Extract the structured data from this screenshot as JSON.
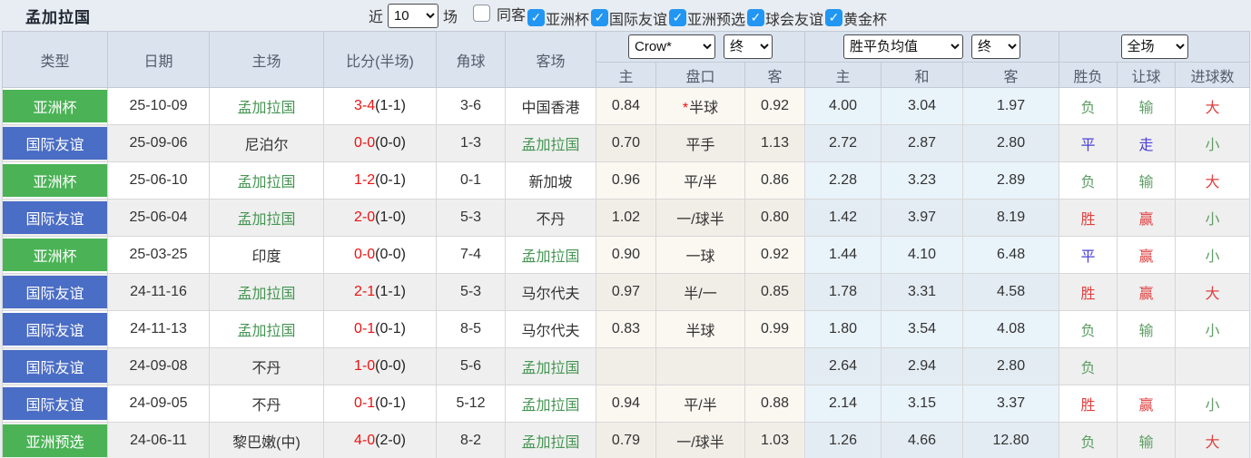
{
  "header_bar": {
    "title": "孟加拉国",
    "recent_label": "近",
    "recent_value": "10",
    "matches_label": "场",
    "checkboxes": [
      {
        "label": "同客",
        "checked": false
      },
      {
        "label": "亚洲杯",
        "checked": true
      },
      {
        "label": "国际友谊",
        "checked": true
      },
      {
        "label": "亚洲预选",
        "checked": true
      },
      {
        "label": "球会友谊",
        "checked": true
      },
      {
        "label": "黄金杯",
        "checked": true
      }
    ]
  },
  "table": {
    "columns": {
      "type": "类型",
      "date": "日期",
      "home": "主场",
      "score": "比分(半场)",
      "corners": "角球",
      "away": "客场"
    },
    "selects": {
      "company": "Crow*",
      "asian_time": "终",
      "euro": "胜平负均值",
      "euro_time": "终",
      "scope": "全场"
    },
    "subheaders": [
      "主",
      "盘口",
      "客",
      "主",
      "和",
      "客",
      "胜负",
      "让球",
      "进球数"
    ],
    "rows": [
      {
        "type": "亚洲杯",
        "type_color": "green",
        "date": "25-10-09",
        "home": "孟加拉国",
        "home_focus": true,
        "score_ft": "3-4",
        "score_ht": "(1-1)",
        "corners": "3-6",
        "away": "中国香港",
        "away_focus": false,
        "asian_home": "0.84",
        "handicap": "半球",
        "handicap_star": true,
        "asian_away": "0.92",
        "euro_home": "4.00",
        "euro_draw": "3.04",
        "euro_away": "1.97",
        "result": "负",
        "handicap_result": "输",
        "goals": "大"
      },
      {
        "type": "国际友谊",
        "type_color": "blue",
        "date": "25-09-06",
        "home": "尼泊尔",
        "home_focus": false,
        "score_ft": "0-0",
        "score_ht": "(0-0)",
        "corners": "1-3",
        "away": "孟加拉国",
        "away_focus": true,
        "asian_home": "0.70",
        "handicap": "平手",
        "handicap_star": false,
        "asian_away": "1.13",
        "euro_home": "2.72",
        "euro_draw": "2.87",
        "euro_away": "2.80",
        "result": "平",
        "handicap_result": "走",
        "goals": "小"
      },
      {
        "type": "亚洲杯",
        "type_color": "green",
        "date": "25-06-10",
        "home": "孟加拉国",
        "home_focus": true,
        "score_ft": "1-2",
        "score_ht": "(0-1)",
        "corners": "0-1",
        "away": "新加坡",
        "away_focus": false,
        "asian_home": "0.96",
        "handicap": "平/半",
        "handicap_star": false,
        "asian_away": "0.86",
        "euro_home": "2.28",
        "euro_draw": "3.23",
        "euro_away": "2.89",
        "result": "负",
        "handicap_result": "输",
        "goals": "大"
      },
      {
        "type": "国际友谊",
        "type_color": "blue",
        "date": "25-06-04",
        "home": "孟加拉国",
        "home_focus": true,
        "score_ft": "2-0",
        "score_ht": "(1-0)",
        "corners": "5-3",
        "away": "不丹",
        "away_focus": false,
        "asian_home": "1.02",
        "handicap": "一/球半",
        "handicap_star": false,
        "asian_away": "0.80",
        "euro_home": "1.42",
        "euro_draw": "3.97",
        "euro_away": "8.19",
        "result": "胜",
        "handicap_result": "赢",
        "goals": "小"
      },
      {
        "type": "亚洲杯",
        "type_color": "green",
        "date": "25-03-25",
        "home": "印度",
        "home_focus": false,
        "score_ft": "0-0",
        "score_ht": "(0-0)",
        "corners": "7-4",
        "away": "孟加拉国",
        "away_focus": true,
        "asian_home": "0.90",
        "handicap": "一球",
        "handicap_star": false,
        "asian_away": "0.92",
        "euro_home": "1.44",
        "euro_draw": "4.10",
        "euro_away": "6.48",
        "result": "平",
        "handicap_result": "赢",
        "goals": "小"
      },
      {
        "type": "国际友谊",
        "type_color": "blue",
        "date": "24-11-16",
        "home": "孟加拉国",
        "home_focus": true,
        "score_ft": "2-1",
        "score_ht": "(1-1)",
        "corners": "5-3",
        "away": "马尔代夫",
        "away_focus": false,
        "asian_home": "0.97",
        "handicap": "半/一",
        "handicap_star": false,
        "asian_away": "0.85",
        "euro_home": "1.78",
        "euro_draw": "3.31",
        "euro_away": "4.58",
        "result": "胜",
        "handicap_result": "赢",
        "goals": "大"
      },
      {
        "type": "国际友谊",
        "type_color": "blue",
        "date": "24-11-13",
        "home": "孟加拉国",
        "home_focus": true,
        "score_ft": "0-1",
        "score_ht": "(0-1)",
        "corners": "8-5",
        "away": "马尔代夫",
        "away_focus": false,
        "asian_home": "0.83",
        "handicap": "半球",
        "handicap_star": false,
        "asian_away": "0.99",
        "euro_home": "1.80",
        "euro_draw": "3.54",
        "euro_away": "4.08",
        "result": "负",
        "handicap_result": "输",
        "goals": "小"
      },
      {
        "type": "国际友谊",
        "type_color": "blue",
        "date": "24-09-08",
        "home": "不丹",
        "home_focus": false,
        "score_ft": "1-0",
        "score_ht": "(0-0)",
        "corners": "5-6",
        "away": "孟加拉国",
        "away_focus": true,
        "asian_home": "",
        "handicap": "",
        "handicap_star": false,
        "asian_away": "",
        "euro_home": "2.64",
        "euro_draw": "2.94",
        "euro_away": "2.80",
        "result": "负",
        "handicap_result": "",
        "goals": ""
      },
      {
        "type": "国际友谊",
        "type_color": "blue",
        "date": "24-09-05",
        "home": "不丹",
        "home_focus": false,
        "score_ft": "0-1",
        "score_ht": "(0-1)",
        "corners": "5-12",
        "away": "孟加拉国",
        "away_focus": true,
        "asian_home": "0.94",
        "handicap": "平/半",
        "handicap_star": false,
        "asian_away": "0.88",
        "euro_home": "2.14",
        "euro_draw": "3.15",
        "euro_away": "3.37",
        "result": "胜",
        "handicap_result": "赢",
        "goals": "小"
      },
      {
        "type": "亚洲预选",
        "type_color": "green",
        "date": "24-06-11",
        "home": "黎巴嫩(中)",
        "home_focus": false,
        "score_ft": "4-0",
        "score_ht": "(2-0)",
        "corners": "8-2",
        "away": "孟加拉国",
        "away_focus": true,
        "asian_home": "0.79",
        "handicap": "一/球半",
        "handicap_star": false,
        "asian_away": "1.03",
        "euro_home": "1.26",
        "euro_draw": "4.66",
        "euro_away": "12.80",
        "result": "负",
        "handicap_result": "输",
        "goals": "大"
      }
    ]
  },
  "value_colors": {
    "胜": "red",
    "平": "blue",
    "负": "green",
    "赢": "red",
    "走": "blue",
    "输": "green",
    "大": "red",
    "小": "green"
  },
  "colors": {
    "red": "#e04040",
    "green": "#5f9e66",
    "blue": "#4a3fd8",
    "score_red": "#ee1111",
    "team_green": "#449552",
    "badge_green": "#4bb356",
    "badge_blue": "#4a6dc5",
    "checkbox_blue": "#2196f3",
    "header_bg": "#dbe3ef"
  }
}
